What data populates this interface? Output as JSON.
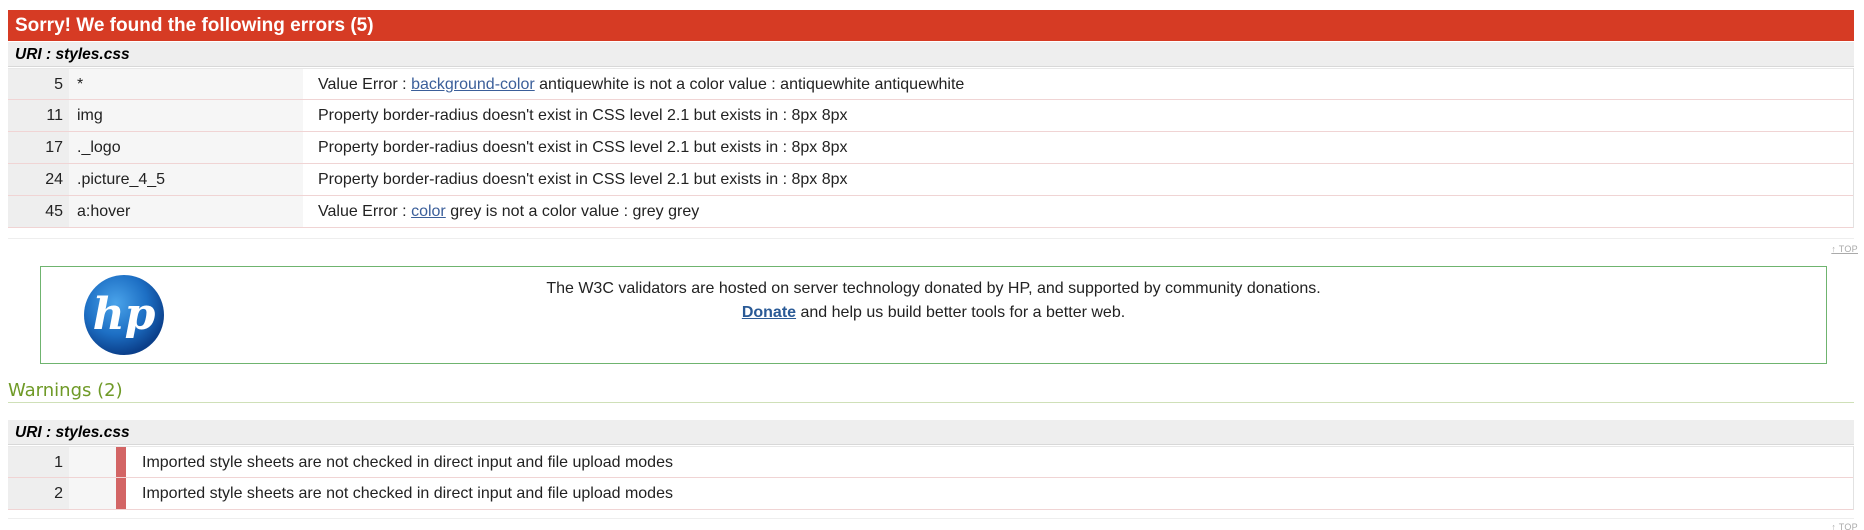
{
  "errors": {
    "header": "Sorry! We found the following errors (5)",
    "uri_label": "URI : styles.css",
    "rows": [
      {
        "line": "5",
        "context": "*",
        "msg_prefix": "Value Error : ",
        "link": "background-color",
        "msg_suffix": " antiquewhite is not a color value : antiquewhite antiquewhite"
      },
      {
        "line": "11",
        "context": "img",
        "msg_prefix": "Property border-radius doesn't exist in CSS level 2.1 but exists in : 8px 8px",
        "link": "",
        "msg_suffix": ""
      },
      {
        "line": "17",
        "context": "._logo",
        "msg_prefix": "Property border-radius doesn't exist in CSS level 2.1 but exists in : 8px 8px",
        "link": "",
        "msg_suffix": ""
      },
      {
        "line": "24",
        "context": ".picture_4_5",
        "msg_prefix": "Property border-radius doesn't exist in CSS level 2.1 but exists in : 8px 8px",
        "link": "",
        "msg_suffix": ""
      },
      {
        "line": "45",
        "context": "a:hover",
        "msg_prefix": "Value Error : ",
        "link": "color",
        "msg_suffix": " grey is not a color value : grey grey"
      }
    ],
    "top_label": "↑ TOP"
  },
  "donation": {
    "line1": "The W3C validators are hosted on server technology donated by HP, and supported by community donations.",
    "donate_link": "Donate",
    "line2_suffix": " and help us build better tools for a better web.",
    "logo_text": "hp"
  },
  "warnings": {
    "title": "Warnings (2)",
    "uri_label": "URI : styles.css",
    "rows": [
      {
        "line": "1",
        "msg": "Imported style sheets are not checked in direct input and file upload modes"
      },
      {
        "line": "2",
        "msg": "Imported style sheets are not checked in direct input and file upload modes"
      }
    ],
    "top_label": "↑ TOP"
  },
  "colors": {
    "error_header": "#d63b24",
    "warning_title": "#6f9a27",
    "warning_bar": "#d36565",
    "link": "#3b5f9a",
    "hp_blue": "#1d6fc4"
  }
}
